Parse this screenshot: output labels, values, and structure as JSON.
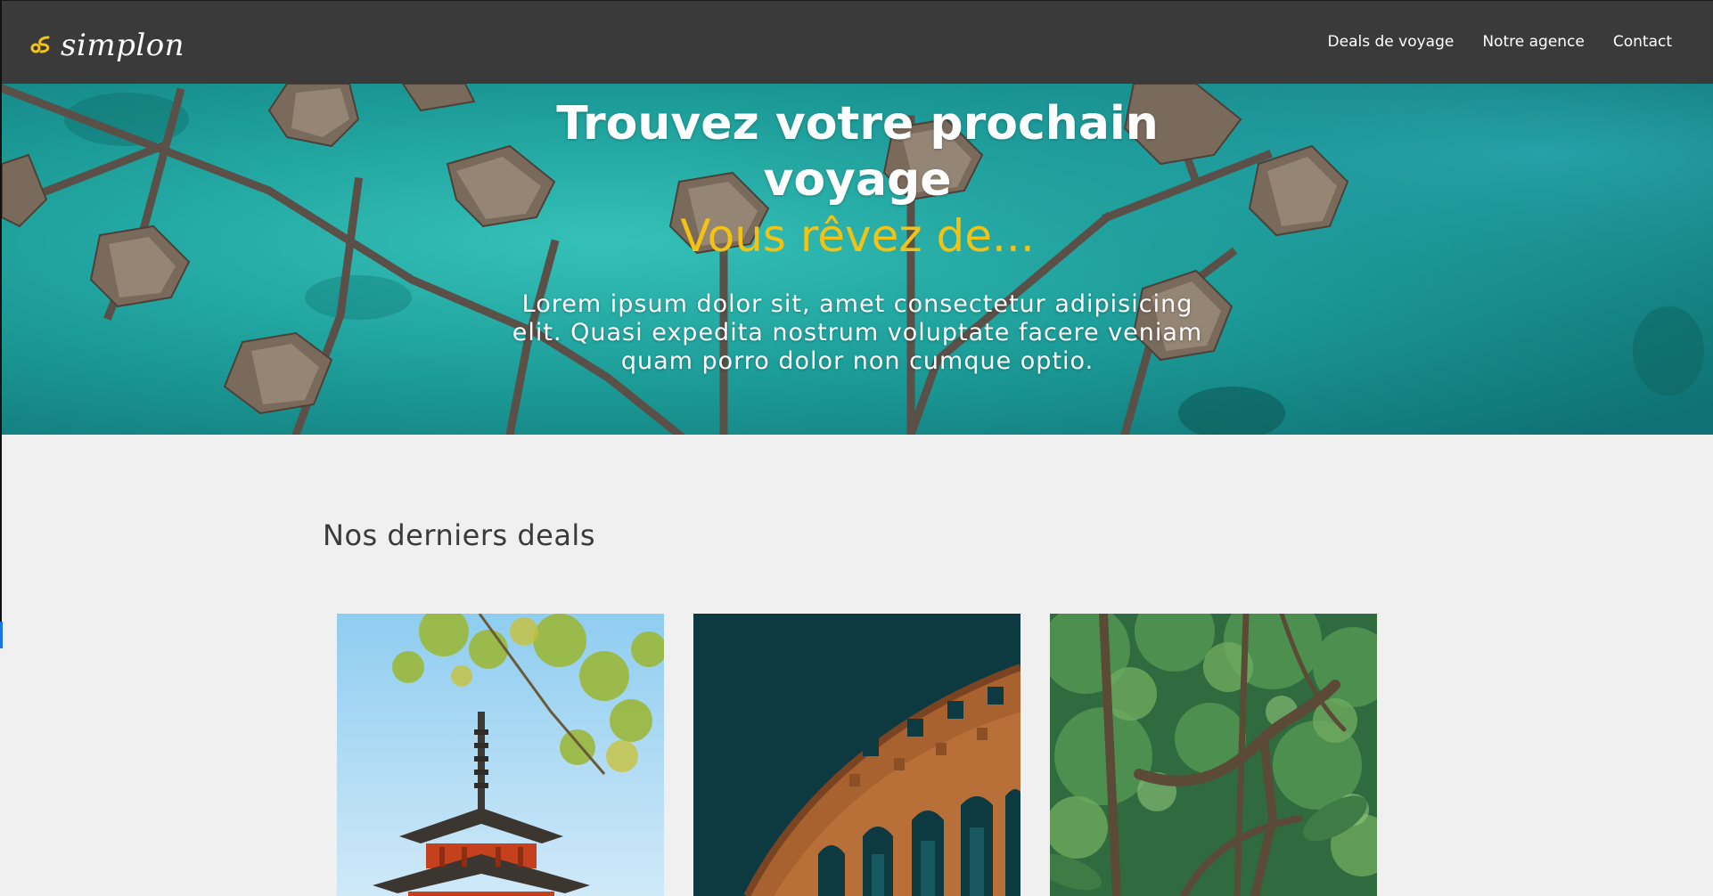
{
  "brand": {
    "name": "simplon",
    "accent": "#f2c215",
    "logo_icon": "simplon-logo-icon"
  },
  "nav": {
    "items": [
      {
        "label": "Deals de voyage"
      },
      {
        "label": "Notre agence"
      },
      {
        "label": "Contact"
      }
    ]
  },
  "hero": {
    "title": "Trouvez votre prochain voyage",
    "subtitle": "Vous rêvez de...",
    "text": "Lorem ipsum dolor sit, amet consectetur adipisicing elit. Quasi expedita nostrum voluptate facere veniam quam porro dolor non cumque optio.",
    "background_image": "aerial-overwater-bungalows-image"
  },
  "deals": {
    "title": "Nos derniers deals",
    "cards": [
      {
        "image": "japanese-pagoda-image"
      },
      {
        "image": "roman-amphitheatre-image"
      },
      {
        "image": "tropical-jungle-image"
      }
    ]
  },
  "colors": {
    "header_bg": "#3a3a3a",
    "page_bg": "#f0f0f0",
    "lagoon": "#1d9c9b"
  }
}
